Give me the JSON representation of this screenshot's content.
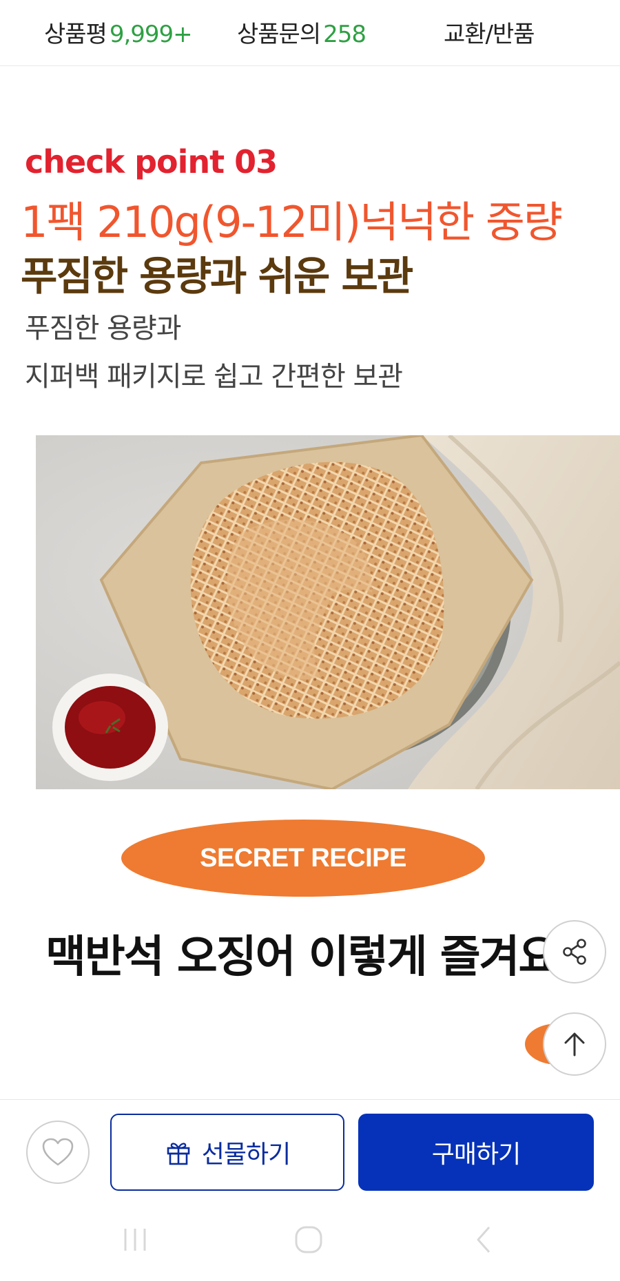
{
  "tabs": {
    "review_label": "상품평",
    "review_count": "9,999+",
    "qna_label": "상품문의",
    "qna_count": "258",
    "return_label": "교환/반품"
  },
  "content": {
    "checkpoint": "check point 03",
    "headline_orange": "1팩 210g(9-12미)넉넉한 중량",
    "headline_brown": "푸짐한 용량과 쉬운 보관",
    "desc_line1": "푸짐한 용량과",
    "desc_line2": "지퍼백 패키지로 쉽고 간편한 보관",
    "secret_badge": "SECRET RECIPE",
    "recipe_title": "맥반석 오징어 이렇게 즐겨요!"
  },
  "bottom_bar": {
    "gift_label": "선물하기",
    "buy_label": "구매하기"
  },
  "icons": {
    "share": "share-icon",
    "scroll_top": "arrow-up-icon",
    "wishlist": "heart-icon",
    "gift": "gift-icon",
    "nav_recent": "recent-apps-icon",
    "nav_home": "home-icon",
    "nav_back": "back-icon"
  },
  "colors": {
    "review_count": "#2ea043",
    "checkpoint": "#e2222f",
    "headline_orange": "#f0562e",
    "headline_brown": "#5b3a0e",
    "secret_badge": "#ee7b31",
    "primary": "#0532b8"
  }
}
